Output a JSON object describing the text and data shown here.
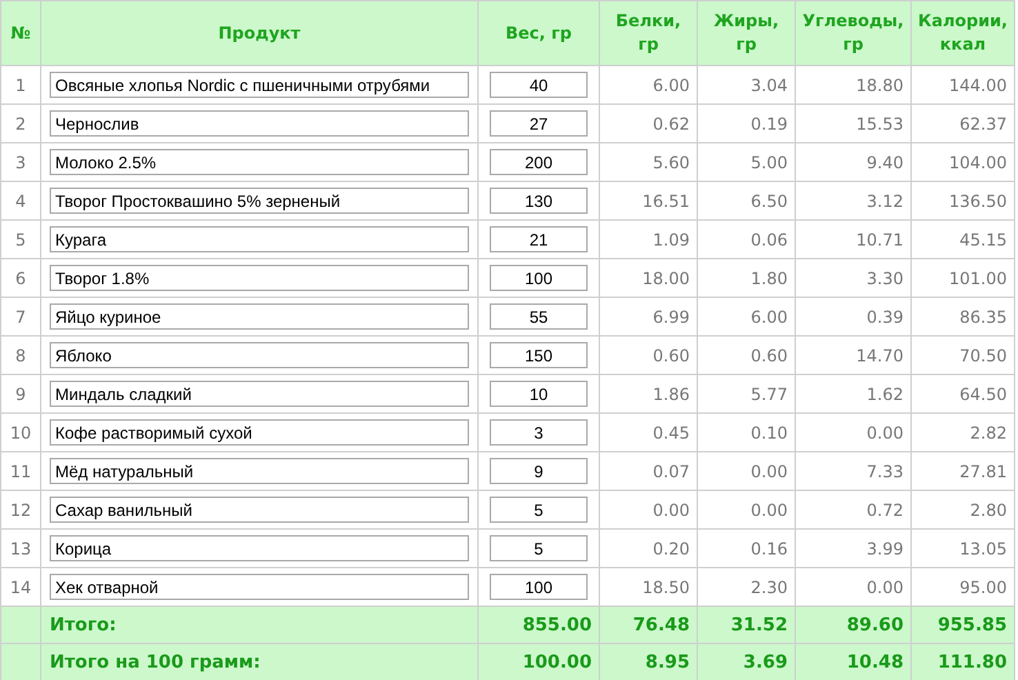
{
  "table": {
    "columns": [
      "№",
      "Продукт",
      "Вес, гр",
      "Белки, гр",
      "Жиры, гр",
      "Углеводы, гр",
      "Калории, ккал"
    ],
    "rows": [
      {
        "n": "1",
        "product": "Овсяные хлопья Nordic с пшеничными отрубями",
        "weight": "40",
        "protein": "6.00",
        "fat": "3.04",
        "carbs": "18.80",
        "kcal": "144.00"
      },
      {
        "n": "2",
        "product": "Чернослив",
        "weight": "27",
        "protein": "0.62",
        "fat": "0.19",
        "carbs": "15.53",
        "kcal": "62.37"
      },
      {
        "n": "3",
        "product": "Молоко 2.5%",
        "weight": "200",
        "protein": "5.60",
        "fat": "5.00",
        "carbs": "9.40",
        "kcal": "104.00"
      },
      {
        "n": "4",
        "product": "Творог Простоквашино 5% зерненый",
        "weight": "130",
        "protein": "16.51",
        "fat": "6.50",
        "carbs": "3.12",
        "kcal": "136.50"
      },
      {
        "n": "5",
        "product": "Курага",
        "weight": "21",
        "protein": "1.09",
        "fat": "0.06",
        "carbs": "10.71",
        "kcal": "45.15"
      },
      {
        "n": "6",
        "product": "Творог 1.8%",
        "weight": "100",
        "protein": "18.00",
        "fat": "1.80",
        "carbs": "3.30",
        "kcal": "101.00"
      },
      {
        "n": "7",
        "product": "Яйцо куриное",
        "weight": "55",
        "protein": "6.99",
        "fat": "6.00",
        "carbs": "0.39",
        "kcal": "86.35"
      },
      {
        "n": "8",
        "product": "Яблоко",
        "weight": "150",
        "protein": "0.60",
        "fat": "0.60",
        "carbs": "14.70",
        "kcal": "70.50"
      },
      {
        "n": "9",
        "product": "Миндаль сладкий",
        "weight": "10",
        "protein": "1.86",
        "fat": "5.77",
        "carbs": "1.62",
        "kcal": "64.50"
      },
      {
        "n": "10",
        "product": "Кофе растворимый сухой",
        "weight": "3",
        "protein": "0.45",
        "fat": "0.10",
        "carbs": "0.00",
        "kcal": "2.82"
      },
      {
        "n": "11",
        "product": "Мёд натуральный",
        "weight": "9",
        "protein": "0.07",
        "fat": "0.00",
        "carbs": "7.33",
        "kcal": "27.81"
      },
      {
        "n": "12",
        "product": "Сахар ванильный",
        "weight": "5",
        "protein": "0.00",
        "fat": "0.00",
        "carbs": "0.72",
        "kcal": "2.80"
      },
      {
        "n": "13",
        "product": "Корица",
        "weight": "5",
        "protein": "0.20",
        "fat": "0.16",
        "carbs": "3.99",
        "kcal": "13.05"
      },
      {
        "n": "14",
        "product": "Хек отварной",
        "weight": "100",
        "protein": "18.50",
        "fat": "2.30",
        "carbs": "0.00",
        "kcal": "95.00"
      }
    ],
    "totals": [
      {
        "label": "Итого:",
        "weight": "855.00",
        "protein": "76.48",
        "fat": "31.52",
        "carbs": "89.60",
        "kcal": "955.85"
      },
      {
        "label": "Итого на 100 грамм:",
        "weight": "100.00",
        "protein": "8.95",
        "fat": "3.69",
        "carbs": "10.48",
        "kcal": "111.80"
      }
    ]
  }
}
